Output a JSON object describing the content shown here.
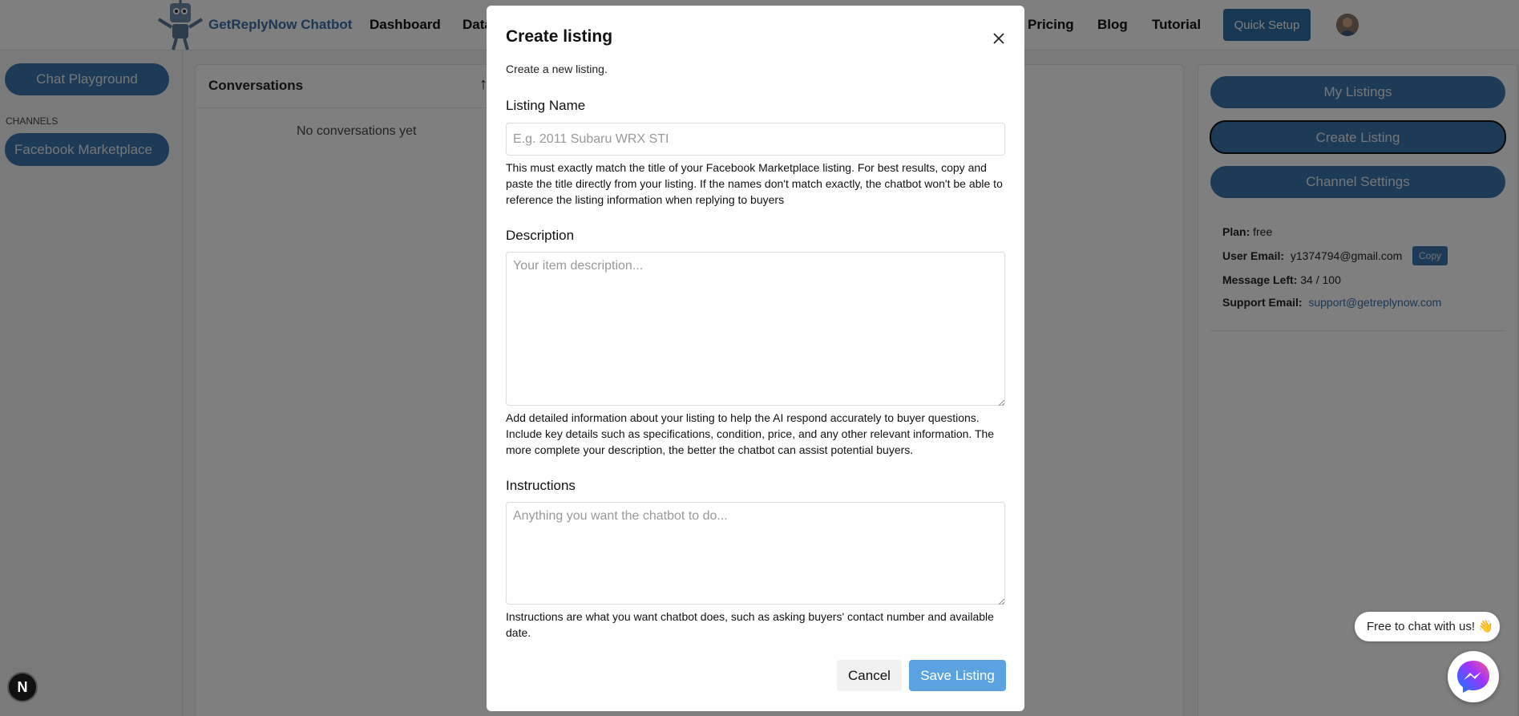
{
  "header": {
    "brand": "GetReplyNow Chatbot",
    "nav": {
      "dashboard": "Dashboard",
      "data_partial": "Data",
      "pricing": "Pricing",
      "blog": "Blog",
      "tutorial": "Tutorial"
    },
    "quick_setup": "Quick Setup"
  },
  "sidebar": {
    "chat_playground": "Chat Playground",
    "channels_label": "CHANNELS",
    "channels": [
      "Facebook Marketplace"
    ]
  },
  "conversations": {
    "title": "Conversations",
    "empty": "No conversations yet"
  },
  "right_panel": {
    "my_listings": "My Listings",
    "create_listing": "Create Listing",
    "channel_settings": "Channel Settings",
    "plan_label": "Plan:",
    "plan_value": "free",
    "user_email_label": "User Email:",
    "user_email_value": "y1374794@gmail.com",
    "copy": "Copy",
    "message_left_label": "Message Left:",
    "message_left_value": "34 / 100",
    "support_email_label": "Support Email:",
    "support_email_value": "support@getreplynow.com"
  },
  "chat_widget": {
    "bubble": "Free to chat with us! 👋"
  },
  "dev_badge": "N",
  "modal": {
    "title": "Create listing",
    "subtitle": "Create a new listing.",
    "listing_name": {
      "label": "Listing Name",
      "placeholder": "E.g. 2011 Subaru WRX STI",
      "help": "This must exactly match the title of your Facebook Marketplace listing. For best results, copy and paste the title directly from your listing. If the names don't match exactly, the chatbot won't be able to reference the listing information when replying to buyers"
    },
    "description": {
      "label": "Description",
      "placeholder": "Your item description...",
      "help": "Add detailed information about your listing to help the AI respond accurately to buyer questions. Include key details such as specifications, condition, price, and any other relevant information. The more complete your description, the better the chatbot can assist potential buyers."
    },
    "instructions": {
      "label": "Instructions",
      "placeholder": "Anything you want the chatbot to do...",
      "help": "Instructions are what you want chatbot does, such as asking buyers' contact number and available date."
    },
    "cancel": "Cancel",
    "save": "Save Listing"
  },
  "colors": {
    "accent": "#3b74ad",
    "save_button": "#5ba3e0",
    "brand_text": "#3a6fa8"
  },
  "icons": [
    "robot-logo-icon",
    "close-icon",
    "sort-arrow-icon",
    "messenger-icon",
    "resize-grip-icon"
  ]
}
